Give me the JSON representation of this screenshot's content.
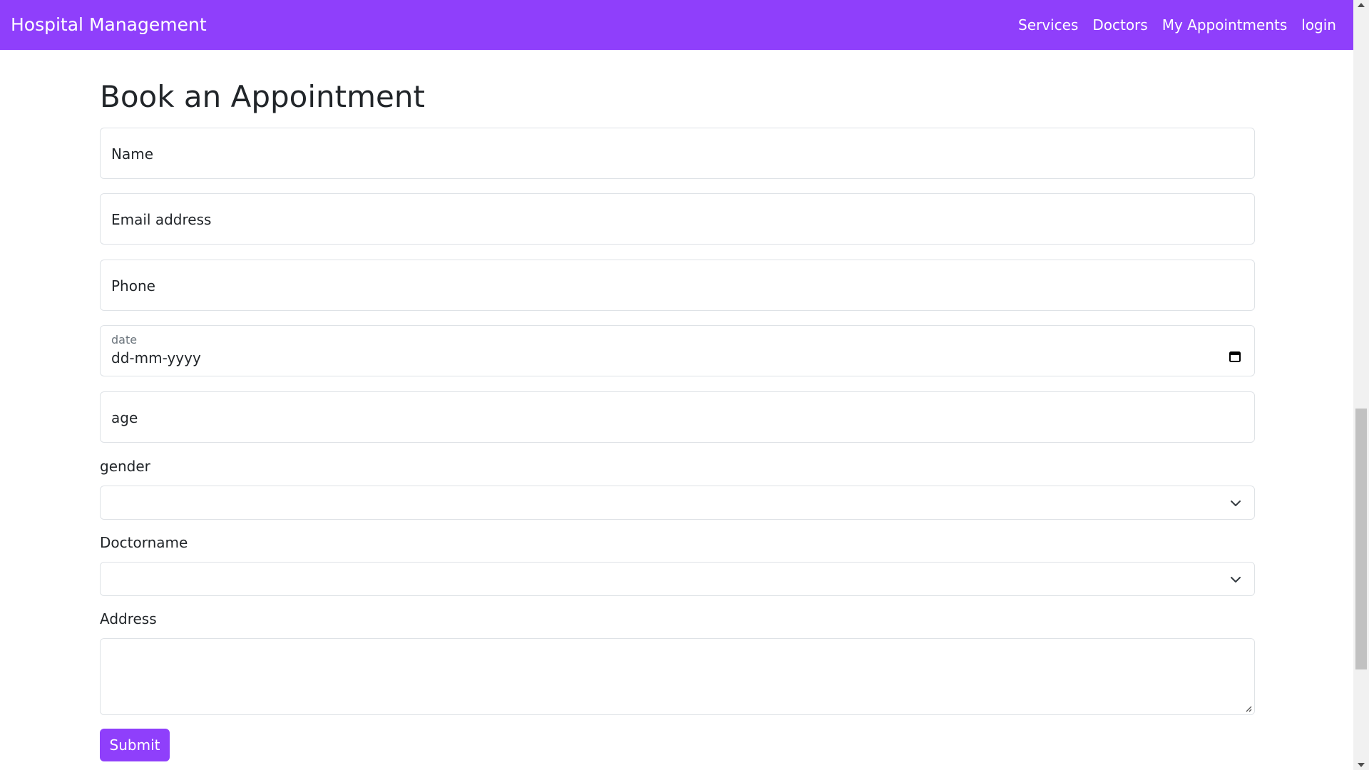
{
  "navbar": {
    "brand": "Hospital Management",
    "links": [
      "Services",
      "Doctors",
      "My Appointments",
      "login"
    ],
    "background_color": "#8f3ffb"
  },
  "form": {
    "title": "Book an Appointment",
    "name_label": "Name",
    "email_label": "Email address",
    "phone_label": "Phone",
    "date_label": "date",
    "date_placeholder": "dd-mm-yyyy",
    "age_label": "age",
    "gender_label": "gender",
    "gender_value": "",
    "doctor_label": "Doctorname",
    "doctor_value": "",
    "address_label": "Address",
    "address_value": "",
    "submit_label": "Submit"
  },
  "icons": {
    "calendar": "calendar-icon",
    "chevron": "chevron-down-icon",
    "resize": "resize-handle-icon"
  },
  "colors": {
    "accent": "#8f3ffb",
    "border": "#dee2e6",
    "text": "#212529"
  }
}
